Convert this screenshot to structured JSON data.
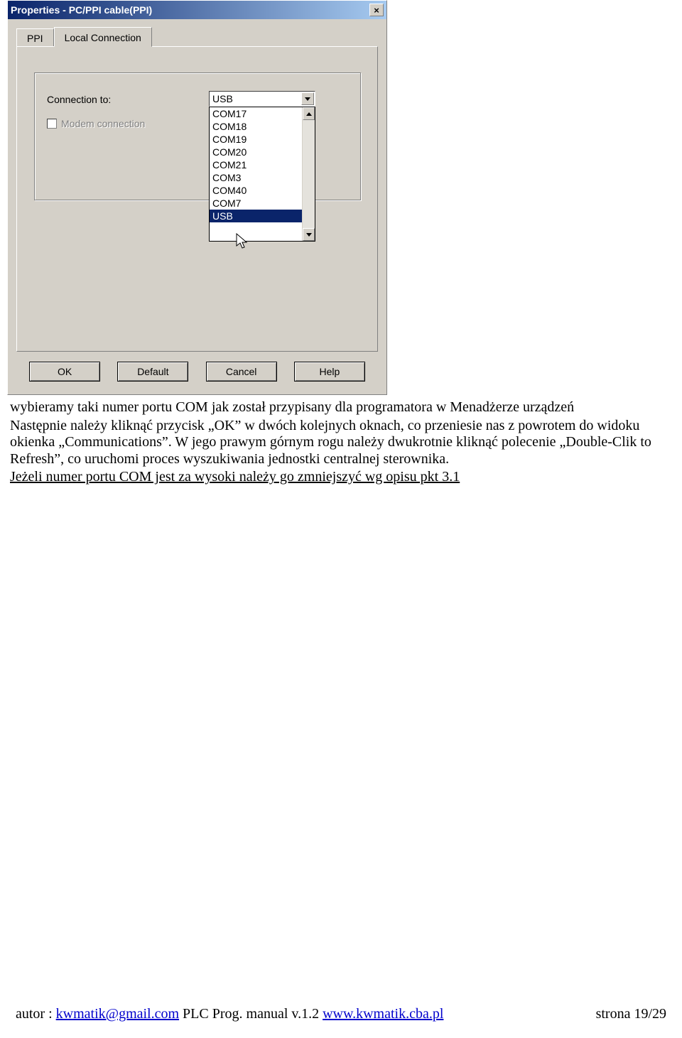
{
  "dialog": {
    "title": "Properties - PC/PPI cable(PPI)",
    "close_glyph": "×",
    "tabs": [
      {
        "label": "PPI"
      },
      {
        "label": "Local Connection"
      }
    ],
    "connection_label": "Connection to:",
    "modem_label": "Modem connection",
    "combo_value": "USB",
    "list_items": [
      "COM17",
      "COM18",
      "COM19",
      "COM20",
      "COM21",
      "COM3",
      "COM40",
      "COM7",
      "USB"
    ],
    "buttons": {
      "ok": "OK",
      "default": "Default",
      "cancel": "Cancel",
      "help": "Help"
    }
  },
  "body": {
    "p1": "wybieramy taki numer portu COM jak został przypisany dla programatora w Menadżerze urządzeń",
    "p2": "Następnie należy kliknąć przycisk „OK” w dwóch kolejnych oknach, co przeniesie nas z powrotem do widoku okienka „Communications”. W jego prawym górnym rogu należy dwukrotnie kliknąć polecenie „Double-Clik to Refresh”, co uruchomi proces wyszukiwania jednostki centralnej sterownika.",
    "p3": "Jeżeli numer portu COM jest za wysoki należy go zmniejszyć wg opisu pkt 3.1"
  },
  "footer": {
    "prefix": "autor : ",
    "email": "kwmatik@gmail.com",
    "mid": "  PLC Prog. manual v.1.2  ",
    "url": "www.kwmatik.cba.pl",
    "page": "strona 19/29"
  }
}
